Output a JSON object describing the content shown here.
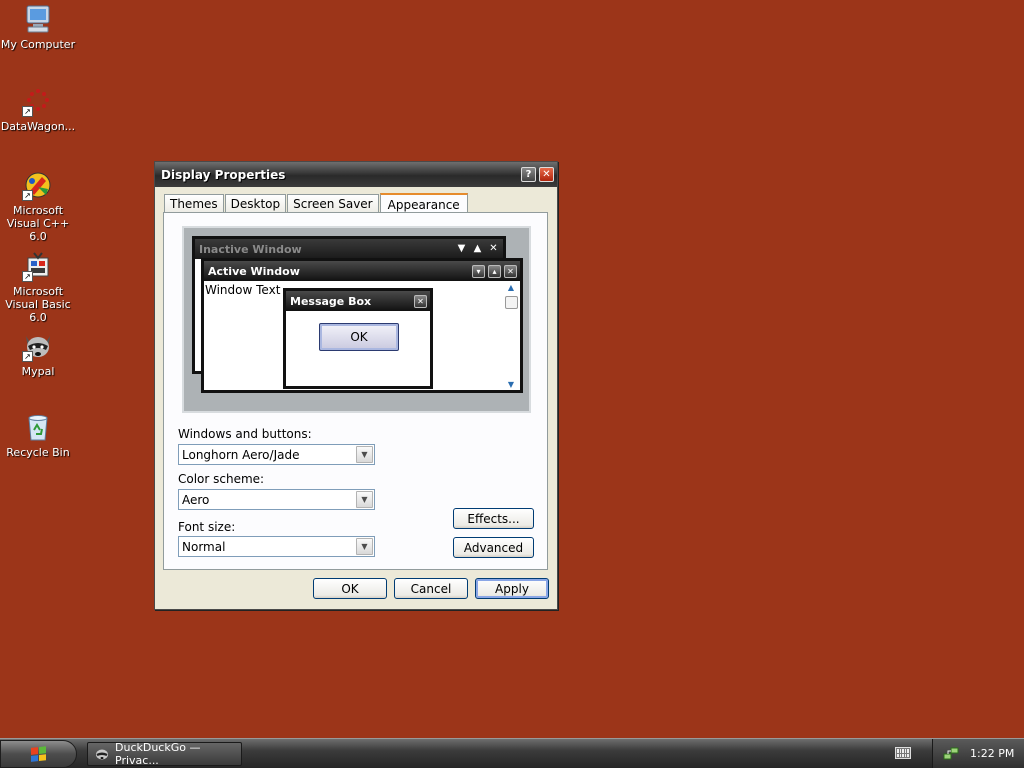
{
  "desktop": {
    "background": "#9c3519",
    "icons": [
      {
        "label": "My Computer",
        "icon": "computer-icon"
      },
      {
        "label": "DataWagon...",
        "icon": "datawagon-icon",
        "shortcut": true
      },
      {
        "label": "Microsoft Visual C++ 6.0",
        "icon": "visual-cpp-icon",
        "shortcut": true
      },
      {
        "label": "Microsoft Visual Basic 6.0",
        "icon": "visual-basic-icon",
        "shortcut": true
      },
      {
        "label": "Mypal",
        "icon": "raccoon-icon",
        "shortcut": true
      },
      {
        "label": "Recycle Bin",
        "icon": "recycle-bin-icon"
      }
    ]
  },
  "dialog": {
    "title": "Display Properties",
    "help_glyph": "?",
    "close_glyph": "✕",
    "tabs": [
      {
        "label": "Themes",
        "active": false
      },
      {
        "label": "Desktop",
        "active": false
      },
      {
        "label": "Screen Saver",
        "active": false
      },
      {
        "label": "Appearance",
        "active": true
      }
    ],
    "preview": {
      "inactive_title": "Inactive Window",
      "active_title": "Active Window",
      "window_text": "Window Text",
      "message_box_title": "Message Box",
      "message_box_ok": "OK"
    },
    "windows_buttons": {
      "label": "Windows and buttons:",
      "value": "Longhorn Aero/Jade"
    },
    "color_scheme": {
      "label": "Color scheme:",
      "value": "Aero"
    },
    "font_size": {
      "label": "Font size:",
      "value": "Normal"
    },
    "effects_label": "Effects...",
    "advanced_label": "Advanced",
    "ok_label": "OK",
    "cancel_label": "Cancel",
    "apply_label": "Apply"
  },
  "taskbar": {
    "task_label": "DuckDuckGo — Privac...",
    "task_icon": "raccoon-icon",
    "tray_icons": [
      "keyboard-icon",
      "network-icon"
    ],
    "clock": "1:22 PM"
  }
}
